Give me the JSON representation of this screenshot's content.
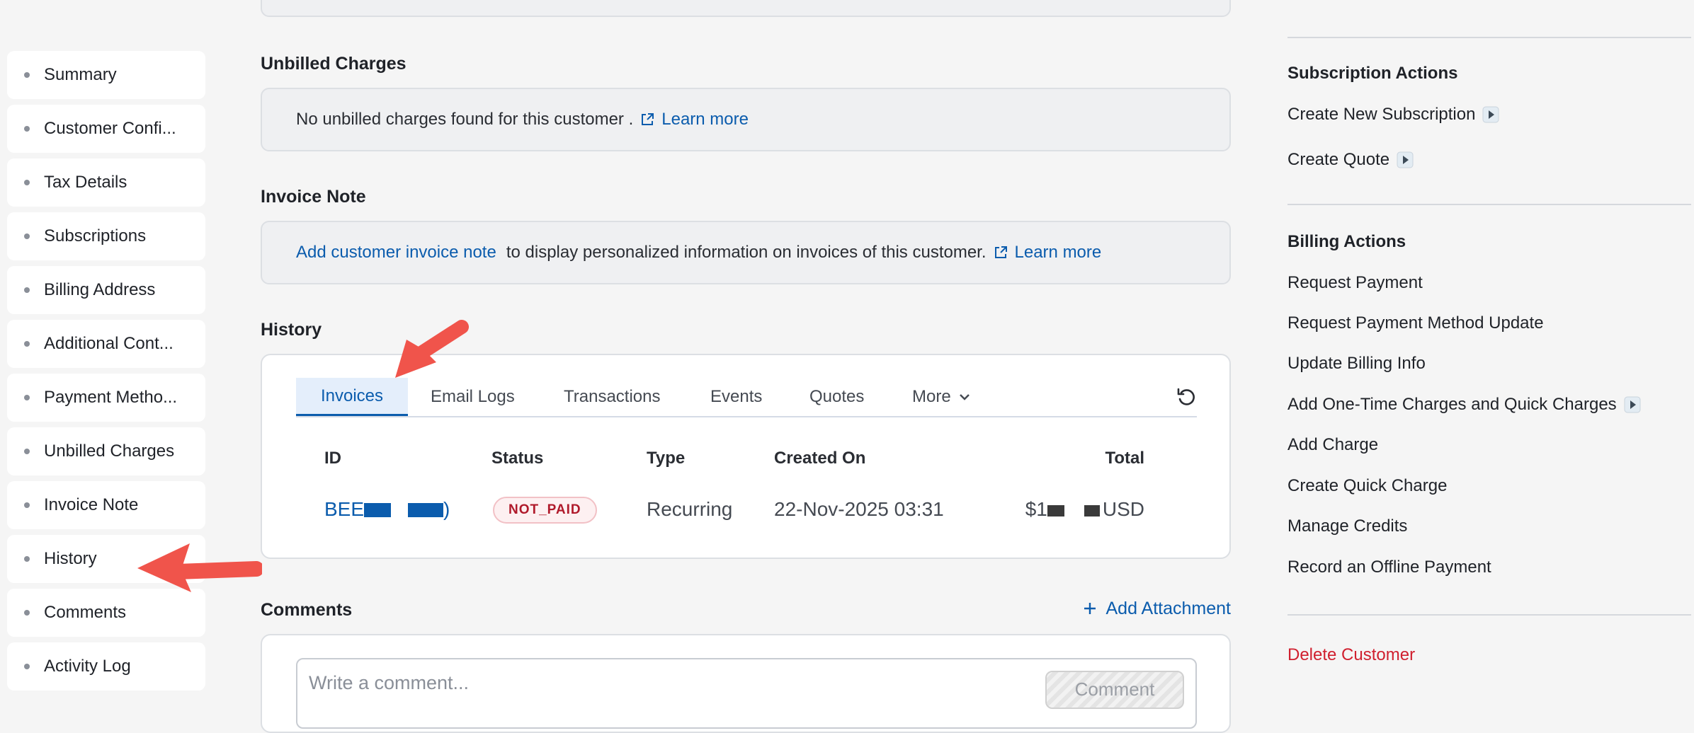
{
  "sidebar": {
    "items": [
      {
        "label": "Summary"
      },
      {
        "label": "Customer Confi..."
      },
      {
        "label": "Tax Details"
      },
      {
        "label": "Subscriptions"
      },
      {
        "label": "Billing Address"
      },
      {
        "label": "Additional Cont..."
      },
      {
        "label": "Payment Metho..."
      },
      {
        "label": "Unbilled Charges"
      },
      {
        "label": "Invoice Note"
      },
      {
        "label": "History"
      },
      {
        "label": "Comments"
      },
      {
        "label": "Activity Log"
      }
    ]
  },
  "main": {
    "unbilled": {
      "title": "Unbilled Charges",
      "message": "No unbilled charges found for this customer .",
      "learn_more": "Learn more"
    },
    "invoice_note": {
      "title": "Invoice Note",
      "add_link": "Add customer invoice note",
      "message": "to display personalized information on invoices of this customer.",
      "learn_more": "Learn more"
    },
    "history": {
      "title": "History",
      "tabs": [
        {
          "label": "Invoices",
          "active": true
        },
        {
          "label": "Email Logs"
        },
        {
          "label": "Transactions"
        },
        {
          "label": "Events"
        },
        {
          "label": "Quotes"
        },
        {
          "label": "More"
        }
      ],
      "columns": {
        "id": "ID",
        "status": "Status",
        "type": "Type",
        "created_on": "Created On",
        "total": "Total"
      },
      "rows": [
        {
          "id_prefix": "BEE",
          "id_suffix": ")",
          "status": "NOT_PAID",
          "type": "Recurring",
          "created_on": "22-Nov-2025 03:31",
          "total_prefix": "$1",
          "total_currency": "USD"
        }
      ]
    },
    "comments": {
      "title": "Comments",
      "add_attachment": "Add Attachment",
      "placeholder": "Write a comment...",
      "submit": "Comment"
    }
  },
  "right": {
    "subscription_actions": {
      "title": "Subscription Actions",
      "items": [
        "Create New Subscription",
        "Create Quote"
      ]
    },
    "billing_actions": {
      "title": "Billing Actions",
      "items": [
        "Request Payment",
        "Request Payment Method Update",
        "Update Billing Info",
        "Add One-Time Charges and Quick Charges",
        "Add Charge",
        "Create Quick Charge",
        "Manage Credits",
        "Record an Offline Payment"
      ]
    },
    "delete": "Delete Customer"
  },
  "colors": {
    "link": "#0b5cad",
    "danger": "#d0202f",
    "badge": "#b01a2b",
    "annotation_arrow": "#f0544b"
  },
  "icons": [
    "external-link-icon",
    "refresh-icon",
    "chevron-down-icon",
    "play-icon",
    "plus-icon",
    "arrow-annotation"
  ]
}
